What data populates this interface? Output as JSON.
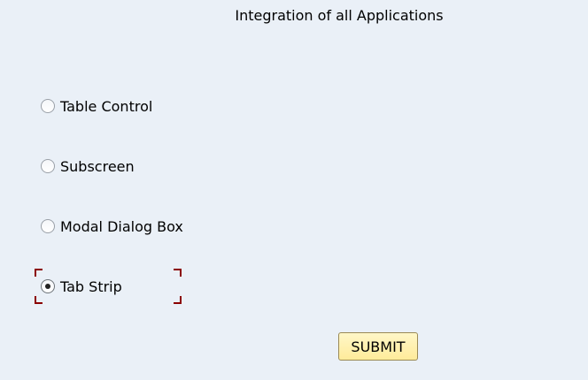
{
  "screen": {
    "title": "Integration of all Applications"
  },
  "options": [
    {
      "label": "Table Control",
      "selected": false
    },
    {
      "label": "Subscreen",
      "selected": false
    },
    {
      "label": "Modal Dialog Box",
      "selected": false
    },
    {
      "label": "Tab Strip",
      "selected": true
    }
  ],
  "actions": {
    "submit_label": "SUBMIT"
  },
  "colors": {
    "background": "#eaf0f7",
    "focus_frame": "#8b0000",
    "button_fill": "#ffeb9a",
    "button_border": "#9a8a55"
  }
}
